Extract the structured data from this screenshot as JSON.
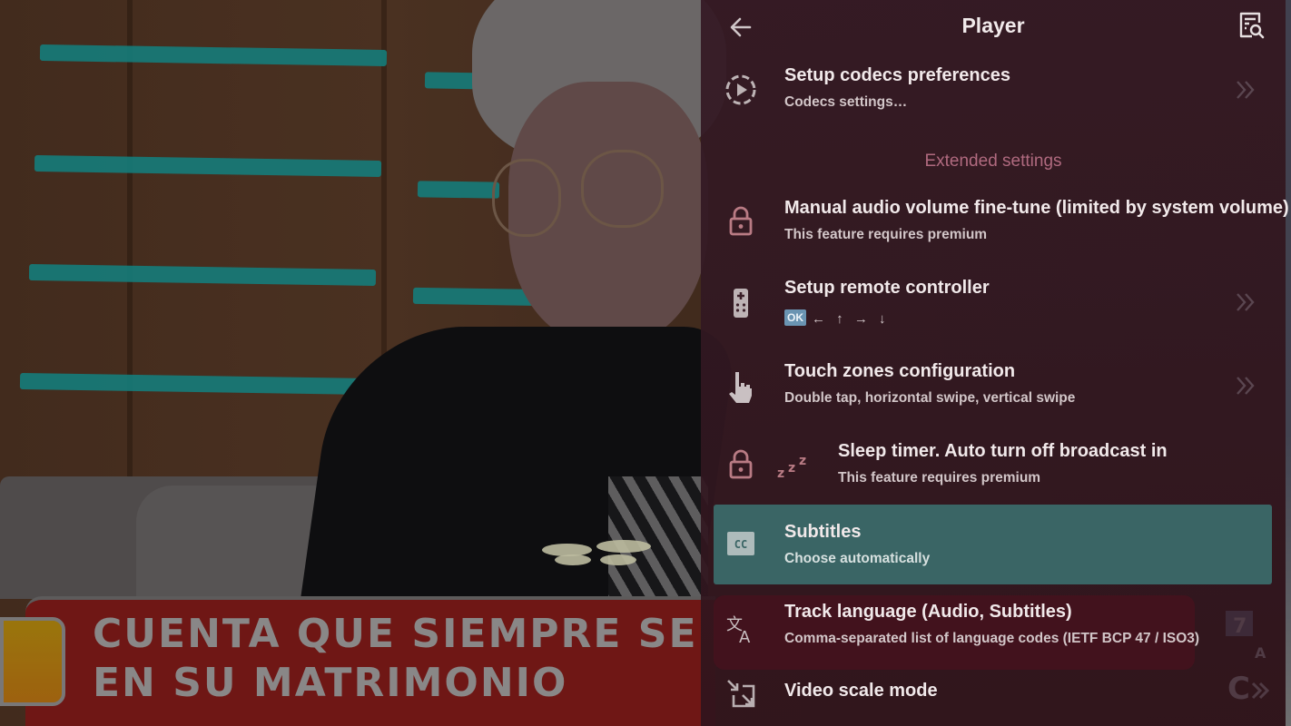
{
  "video": {
    "caption_line1": "CUENTA QUE SIEMPRE SE",
    "caption_line2": "EN SU MATRIMONIO"
  },
  "header": {
    "title": "Player",
    "back_icon": "arrow-left-icon",
    "search_icon": "document-search-icon"
  },
  "section_extended": "Extended settings",
  "items": [
    {
      "icon": "codec-play-icon",
      "title": "Setup codecs preferences",
      "subtitle": "Codecs settings…",
      "has_chevron": true
    },
    {
      "icon": "lock-icon",
      "title": "Manual audio volume fine-tune (limited by system volume)",
      "subtitle": "This feature requires premium",
      "has_chevron": false,
      "locked": true
    },
    {
      "icon": "remote-control-icon",
      "title": "Setup remote controller",
      "subtitle_badge": "OK",
      "subtitle_keys": "← ↑ → ↓",
      "has_chevron": true
    },
    {
      "icon": "touch-hand-icon",
      "title": "Touch zones configuration",
      "subtitle": "Double tap, horizontal swipe, vertical swipe",
      "has_chevron": true
    },
    {
      "icon": "lock-icon",
      "extra_icon": "sleep-zzz-icon",
      "title": "Sleep timer. Auto turn off broadcast in",
      "subtitle": "This feature requires premium",
      "has_chevron": false,
      "locked": true
    },
    {
      "icon": "closed-captions-icon",
      "title": "Subtitles",
      "subtitle": "Choose automatically",
      "selected": true
    },
    {
      "icon": "translate-icon",
      "title": "Track language (Audio, Subtitles)",
      "subtitle": "Comma-separated list of language codes (IETF BCP 47 / ISO3)"
    },
    {
      "icon": "video-scale-icon",
      "title": "Video scale mode",
      "has_chevron": true
    }
  ],
  "colors": {
    "panel_bg": "#321822",
    "selected_bg": "#3a6565",
    "section_header": "#b06a7f",
    "lock_icon": "#b97b84"
  }
}
